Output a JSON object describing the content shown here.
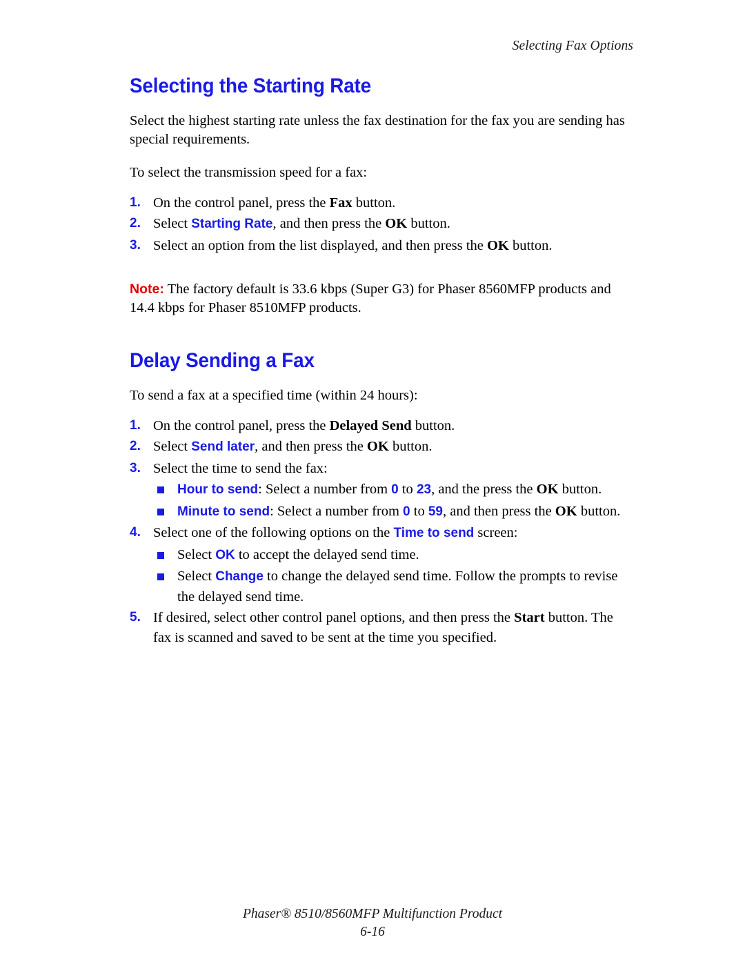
{
  "page": {
    "running_header": "Selecting Fax Options",
    "background_color": "#ffffff",
    "text_color": "#000000",
    "accent_blue": "#1a1ae6",
    "note_red": "#e60000"
  },
  "sections": {
    "starting_rate": {
      "heading": "Selecting the Starting Rate",
      "intro": "Select the highest starting rate unless the fax destination for the fax you are sending has special requirements.",
      "lead_in": "To select the transmission speed for a fax:",
      "steps": {
        "s1_num": "1.",
        "s1_a": "On the control panel, press the ",
        "s1_btn": "Fax",
        "s1_b": " button.",
        "s2_num": "2.",
        "s2_a": "Select ",
        "s2_ui": "Starting Rate",
        "s2_b": ", and then press the ",
        "s2_ok": "OK",
        "s2_c": " button.",
        "s3_num": "3.",
        "s3_a": "Select an option from the list displayed, and then press the ",
        "s3_ok": "OK",
        "s3_b": " button."
      },
      "note": {
        "label": "Note:",
        "text": " The factory default is 33.6 kbps (Super G3) for Phaser 8560MFP products and 14.4 kbps for Phaser 8510MFP products."
      }
    },
    "delay_send": {
      "heading": "Delay Sending a Fax",
      "lead_in": "To send a fax at a specified time (within 24 hours):",
      "steps": {
        "s1_num": "1.",
        "s1_a": "On the control panel, press the ",
        "s1_btn": "Delayed Send",
        "s1_b": " button.",
        "s2_num": "2.",
        "s2_a": "Select ",
        "s2_ui": "Send later",
        "s2_b": ", and then press the ",
        "s2_ok": "OK",
        "s2_c": " button.",
        "s3_num": "3.",
        "s3_a": "Select the time to send the fax:",
        "s3b1_ui": "Hour to send",
        "s3b1_a": ": Select a number from ",
        "s3b1_from": "0",
        "s3b1_b": " to ",
        "s3b1_to": "23",
        "s3b1_c": ", and the press the ",
        "s3b1_ok": "OK",
        "s3b1_d": " button.",
        "s3b2_ui": "Minute to send",
        "s3b2_a": ": Select a number from ",
        "s3b2_from": "0",
        "s3b2_b": " to ",
        "s3b2_to": "59",
        "s3b2_c": ", and then press the ",
        "s3b2_ok": "OK",
        "s3b2_d": " button.",
        "s4_num": "4.",
        "s4_a": "Select one of the following options on the ",
        "s4_ui": "Time to send",
        "s4_b": " screen:",
        "s4b1_a": "Select ",
        "s4b1_ui": "OK",
        "s4b1_b": " to accept the delayed send time.",
        "s4b2_a": "Select ",
        "s4b2_ui": "Change",
        "s4b2_b": " to change the delayed send time. Follow the prompts to revise the delayed send time.",
        "s5_num": "5.",
        "s5_a": "If desired, select other control panel options, and then press the ",
        "s5_btn": "Start",
        "s5_b": " button. The fax is scanned and saved to be sent at the time you specified."
      }
    }
  },
  "footer": {
    "product_line": "Phaser® 8510/8560MFP Multifunction Product",
    "page_number": "6-16"
  }
}
